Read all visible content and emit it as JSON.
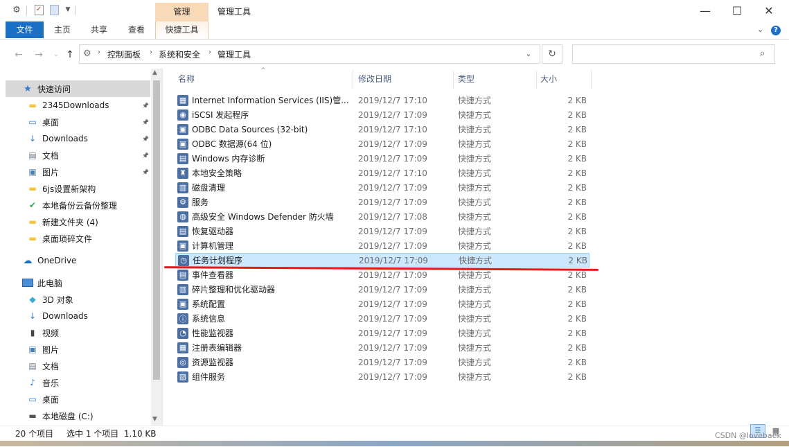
{
  "window": {
    "context_tab": "管理",
    "title": "管理工具",
    "minimize": "—",
    "maximize": "☐",
    "close": "✕"
  },
  "ribbon": {
    "file": "文件",
    "tabs": [
      "主页",
      "共享",
      "查看"
    ],
    "context_subtab": "快捷工具",
    "help": "?"
  },
  "address": {
    "breadcrumb": [
      "控制面板",
      "系统和安全",
      "管理工具"
    ],
    "search_placeholder": ""
  },
  "nav_pane": {
    "quick_access": "快速访问",
    "items": [
      {
        "label": "2345Downloads",
        "icon": "folder-icon",
        "pinned": true
      },
      {
        "label": "桌面",
        "icon": "desktop-icon",
        "pinned": true
      },
      {
        "label": "Downloads",
        "icon": "download-icon",
        "pinned": true
      },
      {
        "label": "文档",
        "icon": "document-icon",
        "pinned": true
      },
      {
        "label": "图片",
        "icon": "picture-icon",
        "pinned": true
      },
      {
        "label": "6js设置新架构",
        "icon": "folder-icon",
        "pinned": false
      },
      {
        "label": "本地备份云备份整理",
        "icon": "folder-sync-icon",
        "pinned": false
      },
      {
        "label": "新建文件夹 (4)",
        "icon": "folder-icon",
        "pinned": false
      },
      {
        "label": "桌面琐碎文件",
        "icon": "folder-icon",
        "pinned": false
      }
    ],
    "onedrive": "OneDrive",
    "this_pc": "此电脑",
    "pc_items": [
      {
        "label": "3D 对象",
        "icon": "cube-3d-icon"
      },
      {
        "label": "Downloads",
        "icon": "download-icon"
      },
      {
        "label": "视频",
        "icon": "video-icon"
      },
      {
        "label": "图片",
        "icon": "picture-icon"
      },
      {
        "label": "文档",
        "icon": "document-icon"
      },
      {
        "label": "音乐",
        "icon": "music-icon"
      },
      {
        "label": "桌面",
        "icon": "desktop-icon"
      },
      {
        "label": "本地磁盘 (C:)",
        "icon": "drive-icon"
      }
    ]
  },
  "columns": {
    "name": "名称",
    "date": "修改日期",
    "type": "类型",
    "size": "大小"
  },
  "files": [
    {
      "name": "Internet Information Services (IIS)管...",
      "date": "2019/12/7 17:10",
      "type": "快捷方式",
      "size": "2 KB"
    },
    {
      "name": "iSCSI 发起程序",
      "date": "2019/12/7 17:09",
      "type": "快捷方式",
      "size": "2 KB"
    },
    {
      "name": "ODBC Data Sources (32-bit)",
      "date": "2019/12/7 17:10",
      "type": "快捷方式",
      "size": "2 KB"
    },
    {
      "name": "ODBC 数据源(64 位)",
      "date": "2019/12/7 17:09",
      "type": "快捷方式",
      "size": "2 KB"
    },
    {
      "name": "Windows 内存诊断",
      "date": "2019/12/7 17:09",
      "type": "快捷方式",
      "size": "2 KB"
    },
    {
      "name": "本地安全策略",
      "date": "2019/12/7 17:10",
      "type": "快捷方式",
      "size": "2 KB"
    },
    {
      "name": "磁盘清理",
      "date": "2019/12/7 17:09",
      "type": "快捷方式",
      "size": "2 KB"
    },
    {
      "name": "服务",
      "date": "2019/12/7 17:09",
      "type": "快捷方式",
      "size": "2 KB"
    },
    {
      "name": "高级安全 Windows Defender 防火墙",
      "date": "2019/12/7 17:08",
      "type": "快捷方式",
      "size": "2 KB"
    },
    {
      "name": "恢复驱动器",
      "date": "2019/12/7 17:09",
      "type": "快捷方式",
      "size": "2 KB"
    },
    {
      "name": "计算机管理",
      "date": "2019/12/7 17:09",
      "type": "快捷方式",
      "size": "2 KB"
    },
    {
      "name": "任务计划程序",
      "date": "2019/12/7 17:09",
      "type": "快捷方式",
      "size": "2 KB",
      "selected": true
    },
    {
      "name": "事件查看器",
      "date": "2019/12/7 17:09",
      "type": "快捷方式",
      "size": "2 KB"
    },
    {
      "name": "碎片整理和优化驱动器",
      "date": "2019/12/7 17:09",
      "type": "快捷方式",
      "size": "2 KB"
    },
    {
      "name": "系统配置",
      "date": "2019/12/7 17:09",
      "type": "快捷方式",
      "size": "2 KB"
    },
    {
      "name": "系统信息",
      "date": "2019/12/7 17:09",
      "type": "快捷方式",
      "size": "2 KB"
    },
    {
      "name": "性能监视器",
      "date": "2019/12/7 17:09",
      "type": "快捷方式",
      "size": "2 KB"
    },
    {
      "name": "注册表编辑器",
      "date": "2019/12/7 17:09",
      "type": "快捷方式",
      "size": "2 KB"
    },
    {
      "name": "资源监视器",
      "date": "2019/12/7 17:09",
      "type": "快捷方式",
      "size": "2 KB"
    },
    {
      "name": "组件服务",
      "date": "2019/12/7 17:09",
      "type": "快捷方式",
      "size": "2 KB"
    }
  ],
  "status": {
    "count": "20 个项目",
    "selection": "选中 1 个项目  1.10 KB"
  },
  "watermark": "CSDN @lovebaek",
  "colors": {
    "file_tab": "#1a6fc7",
    "context_tab": "#f8d9b8",
    "selected_row": "#cce8ff",
    "highlight_line": "#e8191b"
  }
}
